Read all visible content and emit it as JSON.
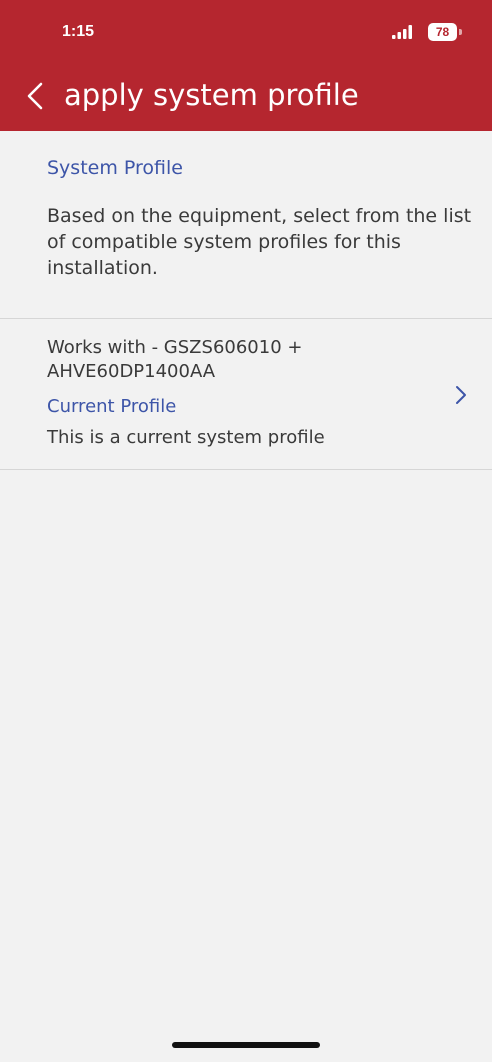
{
  "status_bar": {
    "time": "1:15",
    "battery_level": "78",
    "signal_icon": "signal-bars-icon",
    "battery_icon": "battery-icon"
  },
  "nav": {
    "title": "apply system profile",
    "back_icon": "chevron-left-icon"
  },
  "section": {
    "title": "System Profile",
    "description": "Based on the equipment, select from the list of compatible system profiles for this installation."
  },
  "profiles": [
    {
      "works_with": "Works with - GSZS606010 + AHVE60DP1400AA",
      "name": "Current Profile",
      "description": "This is a current system profile",
      "icon": "chevron-right-icon"
    }
  ],
  "colors": {
    "header_bg": "#b5262f",
    "page_bg": "#f2f2f2",
    "accent_text": "#3d55a8",
    "body_text": "#3a3a3a"
  }
}
